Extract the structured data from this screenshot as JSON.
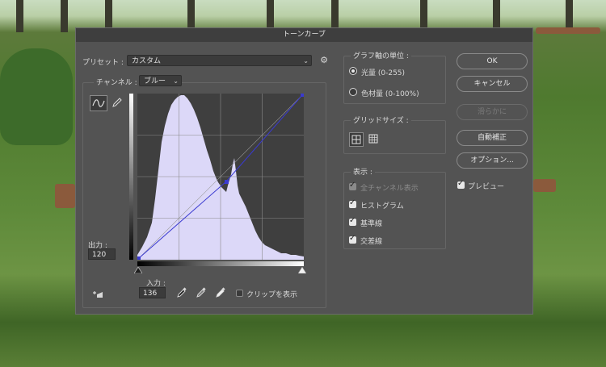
{
  "window": {
    "title": "トーンカーブ"
  },
  "preset": {
    "label": "プリセット :",
    "value": "カスタム"
  },
  "channel": {
    "label": "チャンネル :",
    "value": "ブルー"
  },
  "output": {
    "label": "出力 :",
    "value": "120"
  },
  "input": {
    "label": "入力 :",
    "value": "136"
  },
  "clip": {
    "label": "クリップを表示",
    "checked": false
  },
  "axis_units": {
    "title": "グラフ軸の単位 :",
    "options": [
      {
        "label": "光量 (0-255)",
        "selected": true
      },
      {
        "label": "色材量 (0-100%)",
        "selected": false
      }
    ]
  },
  "grid_size": {
    "title": "グリッドサイズ :"
  },
  "display": {
    "title": "表示 :",
    "items": [
      {
        "label": "全チャンネル表示",
        "checked": true,
        "enabled": false
      },
      {
        "label": "ヒストグラム",
        "checked": true,
        "enabled": true
      },
      {
        "label": "基準線",
        "checked": true,
        "enabled": true
      },
      {
        "label": "交差線",
        "checked": true,
        "enabled": true
      }
    ]
  },
  "buttons": {
    "ok": "OK",
    "cancel": "キャンセル",
    "smooth": "滑らかに",
    "auto": "自動補正",
    "options": "オプション..."
  },
  "preview": {
    "label": "プレビュー",
    "checked": true
  },
  "curve": {
    "channel_color": "#3a3ad0",
    "histogram_color": "#dcd8f8",
    "control_point": {
      "input": 136,
      "output": 120
    }
  }
}
